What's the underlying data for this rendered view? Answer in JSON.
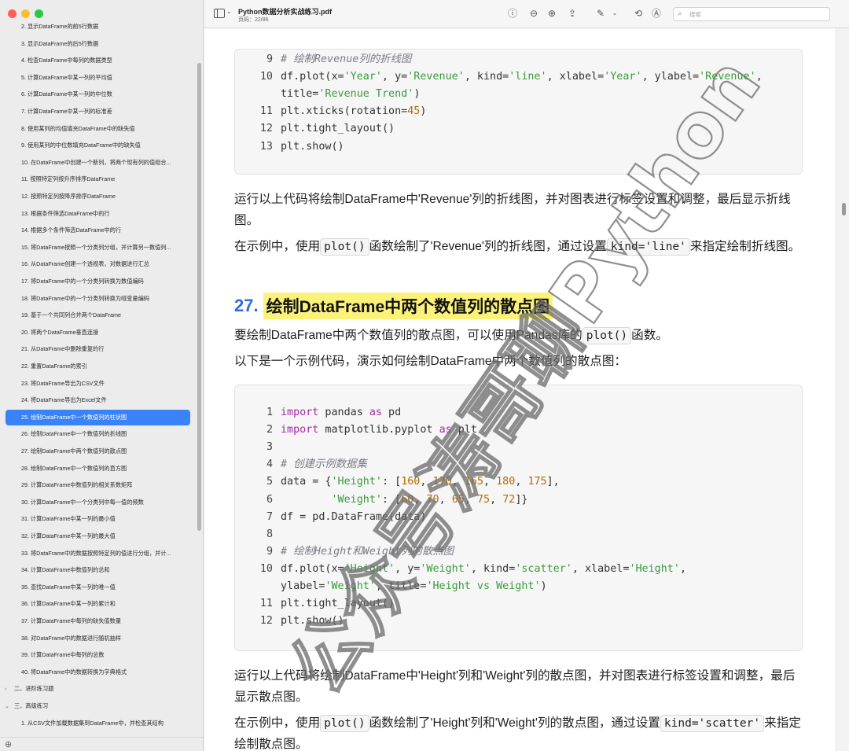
{
  "window": {
    "title": "Python数据分析实战练习.pdf",
    "page_indicator": "页码：22/86",
    "search_placeholder": "搜索",
    "traffic_colors": [
      "#ff5f57",
      "#febc2e",
      "#28c840"
    ]
  },
  "sidebar": {
    "items": [
      "2. 显示DataFrame的前5行数据",
      "3. 显示DataFrame的后5行数据",
      "4. 检查DataFrame中每列的数据类型",
      "5. 计算DataFrame中某一列的平均值",
      "6. 计算DataFrame中某一列的中位数",
      "7. 计算DataFrame中某一列的标准差",
      "8. 使用某列的均值填充DataFrame中的缺失值",
      "9. 使用某列的中位数填充DataFrame中的缺失值",
      "10. 在DataFrame中创建一个新列，将两个现有列的值组合...",
      "11. 按照特定列按升序排序DataFrame",
      "12. 按照特定列按降序排序DataFrame",
      "13. 根据条件筛选DataFrame中的行",
      "14. 根据多个条件筛选DataFrame中的行",
      "15. 将DataFrame按照一个分类列分组，并计算另一数值列...",
      "16. 从DataFrame创建一个透视表，对数据进行汇总",
      "17. 将DataFrame中的一个分类列转换为数值编码",
      "18. 将DataFrame中的一个分类列转换为哑变量编码",
      "19. 基于一个共同列合并两个DataFrame",
      "20. 将两个DataFrame垂直连接",
      "21. 从DataFrame中删除重复的行",
      "22. 重置DataFrame的索引",
      "23. 将DataFrame导出为CSV文件",
      "24. 将DataFrame导出为Excel文件",
      "25. 绘制DataFrame中一个数值列的柱状图",
      "26. 绘制DataFrame中一个数值列的折线图",
      "27. 绘制DataFrame中两个数值列的散点图",
      "28. 绘制DataFrame中一个数值列的直方图",
      "29. 计算DataFrame中数值列的相关系数矩阵",
      "30. 计算DataFrame中一个分类列中每一值的频数",
      "31. 计算DataFrame中某一列的最小值",
      "32. 计算DataFrame中某一列的最大值",
      "33. 将DataFrame中的数据按照特定列的值进行分组，并计...",
      "34. 计算DataFrame中数值列的总和",
      "35. 查找DataFrame中某一列的唯一值",
      "36. 计算DataFrame中某一列的累计和",
      "37. 计算DataFrame中每列的缺失值数量",
      "38. 对DataFrame中的数据进行随机抽样",
      "39. 计算DataFrame中每列的总数",
      "40. 将DataFrame中的数据转换为字典格式"
    ],
    "active_index": 23,
    "section_advanced": "二、进阶练习题",
    "section_expert": "三、高级练习",
    "expert_first_item": "1. 从CSV文件加载数据集到DataFrame中，并检查其结构"
  },
  "content": {
    "code1": {
      "lines": [
        {
          "n": "9",
          "parts": [
            {
              "t": "cmt",
              "v": "# 绘制Revenue列的折线图"
            }
          ]
        },
        {
          "n": "10",
          "parts": [
            {
              "t": "",
              "v": "df.plot(x="
            },
            {
              "t": "str",
              "v": "'Year'"
            },
            {
              "t": "",
              "v": ", y="
            },
            {
              "t": "str",
              "v": "'Revenue'"
            },
            {
              "t": "",
              "v": ", kind="
            },
            {
              "t": "str",
              "v": "'line'"
            },
            {
              "t": "",
              "v": ", xlabel="
            },
            {
              "t": "str",
              "v": "'Year'"
            },
            {
              "t": "",
              "v": ", ylabel="
            },
            {
              "t": "str",
              "v": "'Revenue'"
            },
            {
              "t": "",
              "v": ","
            }
          ]
        },
        {
          "n": "",
          "parts": [
            {
              "t": "",
              "v": "title="
            },
            {
              "t": "str",
              "v": "'Revenue Trend'"
            },
            {
              "t": "",
              "v": ")"
            }
          ]
        },
        {
          "n": "11",
          "parts": [
            {
              "t": "",
              "v": "plt.xticks(rotation="
            },
            {
              "t": "num",
              "v": "45"
            },
            {
              "t": "",
              "v": ")"
            }
          ]
        },
        {
          "n": "12",
          "parts": [
            {
              "t": "",
              "v": "plt.tight_layout()"
            }
          ]
        },
        {
          "n": "13",
          "parts": [
            {
              "t": "",
              "v": "plt.show()"
            }
          ]
        }
      ]
    },
    "para1": "运行以上代码将绘制DataFrame中'Revenue'列的折线图，并对图表进行标签设置和调整，最后显示折线图。",
    "para2_a": "在示例中，使用",
    "para2_code1": "plot()",
    "para2_b": "函数绘制了'Revenue'列的折线图，通过设置",
    "para2_code2": "kind='line'",
    "para2_c": "来指定绘制折线图。",
    "heading_num": "27.",
    "heading_text": "绘制DataFrame中两个数值列的散点图",
    "para3_a": "要绘制DataFrame中两个数值列的散点图，可以使用Pandas库的",
    "para3_code": "plot()",
    "para3_b": "函数。",
    "para4": "以下是一个示例代码，演示如何绘制DataFrame中两个数值列的散点图：",
    "code2": {
      "lines": [
        {
          "n": "1",
          "parts": [
            {
              "t": "kw",
              "v": "import"
            },
            {
              "t": "",
              "v": " pandas "
            },
            {
              "t": "kw",
              "v": "as"
            },
            {
              "t": "",
              "v": " pd"
            }
          ]
        },
        {
          "n": "2",
          "parts": [
            {
              "t": "kw",
              "v": "import"
            },
            {
              "t": "",
              "v": " matplotlib.pyplot "
            },
            {
              "t": "kw",
              "v": "as"
            },
            {
              "t": "",
              "v": " plt"
            }
          ]
        },
        {
          "n": "3",
          "parts": []
        },
        {
          "n": "4",
          "parts": [
            {
              "t": "cmt",
              "v": "# 创建示例数据集"
            }
          ]
        },
        {
          "n": "5",
          "parts": [
            {
              "t": "",
              "v": "data = {"
            },
            {
              "t": "str",
              "v": "'Height'"
            },
            {
              "t": "",
              "v": ": ["
            },
            {
              "t": "num",
              "v": "160"
            },
            {
              "t": "",
              "v": ", "
            },
            {
              "t": "num",
              "v": "170"
            },
            {
              "t": "",
              "v": ", "
            },
            {
              "t": "num",
              "v": "165"
            },
            {
              "t": "",
              "v": ", "
            },
            {
              "t": "num",
              "v": "180"
            },
            {
              "t": "",
              "v": ", "
            },
            {
              "t": "num",
              "v": "175"
            },
            {
              "t": "",
              "v": "],"
            }
          ]
        },
        {
          "n": "6",
          "parts": [
            {
              "t": "",
              "v": "        "
            },
            {
              "t": "str",
              "v": "'Weight'"
            },
            {
              "t": "",
              "v": ": ["
            },
            {
              "t": "num",
              "v": "60"
            },
            {
              "t": "",
              "v": ", "
            },
            {
              "t": "num",
              "v": "70"
            },
            {
              "t": "",
              "v": ", "
            },
            {
              "t": "num",
              "v": "65"
            },
            {
              "t": "",
              "v": ", "
            },
            {
              "t": "num",
              "v": "75"
            },
            {
              "t": "",
              "v": ", "
            },
            {
              "t": "num",
              "v": "72"
            },
            {
              "t": "",
              "v": "]}"
            }
          ]
        },
        {
          "n": "7",
          "parts": [
            {
              "t": "",
              "v": "df = pd.DataFrame(data)"
            }
          ]
        },
        {
          "n": "8",
          "parts": []
        },
        {
          "n": "9",
          "parts": [
            {
              "t": "cmt",
              "v": "# 绘制Height和Weight列的散点图"
            }
          ]
        },
        {
          "n": "10",
          "parts": [
            {
              "t": "",
              "v": "df.plot(x="
            },
            {
              "t": "str",
              "v": "'Height'"
            },
            {
              "t": "",
              "v": ", y="
            },
            {
              "t": "str",
              "v": "'Weight'"
            },
            {
              "t": "",
              "v": ", kind="
            },
            {
              "t": "str",
              "v": "'scatter'"
            },
            {
              "t": "",
              "v": ", xlabel="
            },
            {
              "t": "str",
              "v": "'Height'"
            },
            {
              "t": "",
              "v": ","
            }
          ]
        },
        {
          "n": "",
          "parts": [
            {
              "t": "",
              "v": "ylabel="
            },
            {
              "t": "str",
              "v": "'Weight'"
            },
            {
              "t": "",
              "v": ", title="
            },
            {
              "t": "str",
              "v": "'Height vs Weight'"
            },
            {
              "t": "",
              "v": ")"
            }
          ]
        },
        {
          "n": "11",
          "parts": [
            {
              "t": "",
              "v": "plt.tight_layout()"
            }
          ]
        },
        {
          "n": "12",
          "parts": [
            {
              "t": "",
              "v": "plt.show()"
            }
          ]
        }
      ]
    },
    "para5": "运行以上代码将绘制DataFrame中'Height'列和'Weight'列的散点图，并对图表进行标签设置和调整，最后显示散点图。",
    "para6_a": "在示例中，使用",
    "para6_code1": "plot()",
    "para6_b": "函数绘制了'Height'列和'Weight'列的散点图，通过设置",
    "para6_code2": "kind='scatter'",
    "para6_c": "来指定绘制散点图。"
  },
  "watermark": "公众号涛哥聊Python",
  "icons": [
    "sidebar-toggle-icon",
    "info-icon",
    "zoom-out-icon",
    "zoom-in-icon",
    "share-icon",
    "markup-pen-icon",
    "rotate-icon",
    "accessibility-icon",
    "search-icon"
  ],
  "colors": {
    "accent": "#3a82f7",
    "heading_highlight": "#fbf27a",
    "heading_number": "#2f6bdc"
  }
}
